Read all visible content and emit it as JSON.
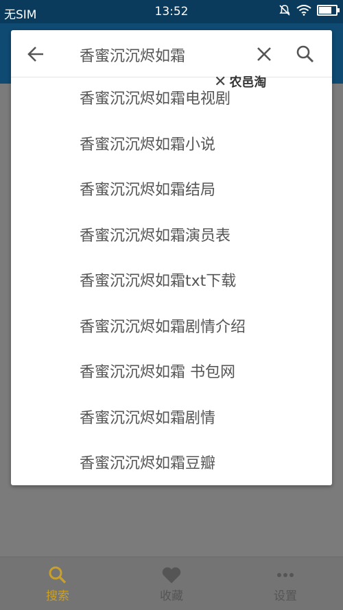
{
  "status_bar": {
    "carrier": "无SIM",
    "time": "13:52"
  },
  "search": {
    "query": "香蜜沉沉烬如霜"
  },
  "watermark": {
    "text": "农邑淘"
  },
  "suggestions": [
    "香蜜沉沉烬如霜电视剧",
    "香蜜沉沉烬如霜小说",
    "香蜜沉沉烬如霜结局",
    "香蜜沉沉烬如霜演员表",
    "香蜜沉沉烬如霜txt下载",
    "香蜜沉沉烬如霜剧情介绍",
    "香蜜沉沉烬如霜 书包网",
    "香蜜沉沉烬如霜剧情",
    "香蜜沉沉烬如霜豆瓣"
  ],
  "bottom_nav": {
    "search_label": "搜索",
    "favorites_label": "收藏",
    "settings_label": "设置"
  },
  "colors": {
    "status_bar": "#0a3a5c",
    "app_bar": "#0e4a72",
    "overlay_background": "#7b7b7b",
    "active_nav": "#c8a02a",
    "inactive_nav": "#555555"
  },
  "icons": {
    "back": "arrow-left-icon",
    "clear": "close-icon",
    "search": "search-icon",
    "fav": "heart-icon",
    "settings": "more-dots-icon"
  }
}
